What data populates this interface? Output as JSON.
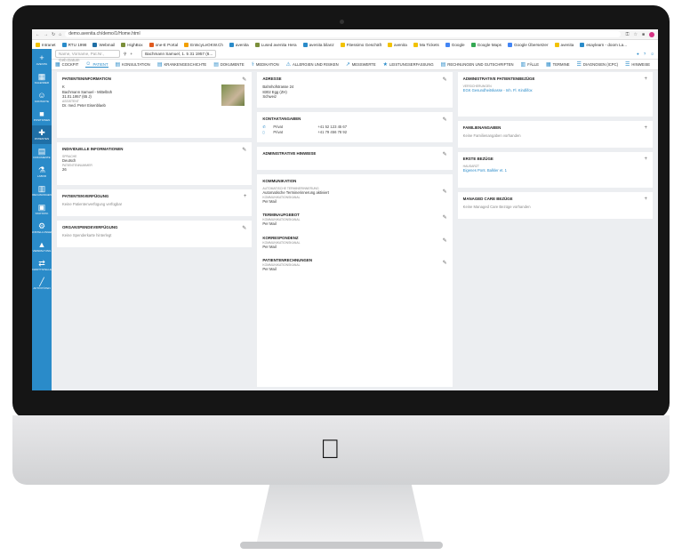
{
  "browser": {
    "url": "demo.avenita.ch/demo/1/Home.html",
    "bookmarks": [
      "Intranet",
      "RTU 1998",
      "Webmail",
      "HighBox",
      "one-E Portal",
      "EntscyLeOKW.Ch",
      "avenita",
      "Lused avenita Hera",
      "avenita bilanz",
      "Fitessimo Geschäft",
      "avenita",
      "Ma Tickets",
      "Google",
      "Google Maps",
      "Google Übersetzer",
      "avenita",
      "esaylearn - doom La..."
    ]
  },
  "sidebar": {
    "items": [
      {
        "label": "Avenita",
        "icon": "plus-icon"
      },
      {
        "label": "Kalender",
        "icon": "calendar-icon"
      },
      {
        "label": "Kontakte",
        "icon": "contacts-icon"
      },
      {
        "label": "Positionen",
        "icon": "positions-icon"
      },
      {
        "label": "Patienten",
        "icon": "patients-icon"
      },
      {
        "label": "Dokumente",
        "icon": "documents-icon"
      },
      {
        "label": "Labor",
        "icon": "lab-icon"
      },
      {
        "label": "Rechnungen",
        "icon": "invoices-icon"
      },
      {
        "label": "Statistik",
        "icon": "statistics-icon"
      },
      {
        "label": "Einstellungen",
        "icon": "settings-icon"
      },
      {
        "label": "Verwaltung",
        "icon": "admin-icon"
      },
      {
        "label": "Schnittstellen",
        "icon": "interfaces-icon"
      },
      {
        "label": "Aktivitäten",
        "icon": "activity-icon"
      }
    ]
  },
  "topbar": {
    "search_placeholder": "Name, Vorname, Pat.Nr., Geb.Datum",
    "patient_tab": "Bachmann Samuel, 1. 5 31 1957 (6..."
  },
  "tabs": [
    "Cockpit",
    "Patient",
    "Konsultation",
    "Krankengeschichte",
    "Dokumente",
    "Medikation",
    "Allergien und Risiken",
    "Messwerte",
    "Leistungserfassung",
    "Rechnungen und Gutschriften",
    "Fälle",
    "Termine",
    "Diagnosen (ICPC)",
    "Hinweise"
  ],
  "col1": {
    "patient": {
      "title": "Patienteninformation",
      "line1": "K",
      "name": "Bachmann Samuel - Mittelbüh",
      "dob": "31.01.1957 (65 J)",
      "assist_label": "Assistent",
      "assist": "Dr. med. Peter Eisenblaeb"
    },
    "personal": {
      "title": "Individuelle Informationen",
      "lang_label": "Sprache",
      "lang": "Deutsch",
      "nr_label": "Patientennummer",
      "nr": "26"
    },
    "disposition": {
      "title": "Patientenverfügung",
      "text": "Keine Patientenverfügung verfügbar"
    },
    "organ": {
      "title": "Organspendeverfügung",
      "text": "Keine Spenderkarte hinterlegt"
    }
  },
  "col2": {
    "address": {
      "title": "Adresse",
      "street": "Bahnhofstrasse 24",
      "city": "8302 Egg (ZH)",
      "country": "Schweiz"
    },
    "contacts": {
      "title": "Kontaktangaben",
      "rows": [
        {
          "type": "Privat",
          "value": "+41 52 123 45 67"
        },
        {
          "type": "Privat",
          "value": "+41 79 456 78 92"
        }
      ]
    },
    "admin_notes": {
      "title": "Administrative Hinweise"
    },
    "communication": {
      "title": "Kommunikation",
      "s1_label": "Automatische Terminerinnerung",
      "s1_text": "Automatische Terminerinnerung aktiviert",
      "s1_sub": "Kommunikationskanal",
      "s1_val": "Per Mail",
      "s2_label": "Terminaufgebot",
      "s2_sub": "Kommunikationskanal",
      "s2_val": "Per Mail",
      "s3_label": "Korrespondenz",
      "s3_sub": "Kommunikationskanal",
      "s3_val": "Per Mail",
      "s4_label": "Patientenrechnungen",
      "s4_sub": "Kommunikationskanal",
      "s4_val": "Per Mail"
    }
  },
  "col3": {
    "relations": {
      "title": "Administrative Patientenbezüge",
      "sub": "Versicherungen",
      "link": "EGK Gesundheitskasse - Inh. Fl. Kindlifox"
    },
    "family": {
      "title": "Familienangaben",
      "text": "Keine Familienangaben vorhanden"
    },
    "care": {
      "title": "Erste Bezüge",
      "sub": "Hausarzt",
      "link": "Eigenes Pont. Balkler et. 1"
    },
    "managed": {
      "title": "Managed Care Bezüge",
      "text": "Keine Managed Care Bezüge vorhanden"
    }
  }
}
